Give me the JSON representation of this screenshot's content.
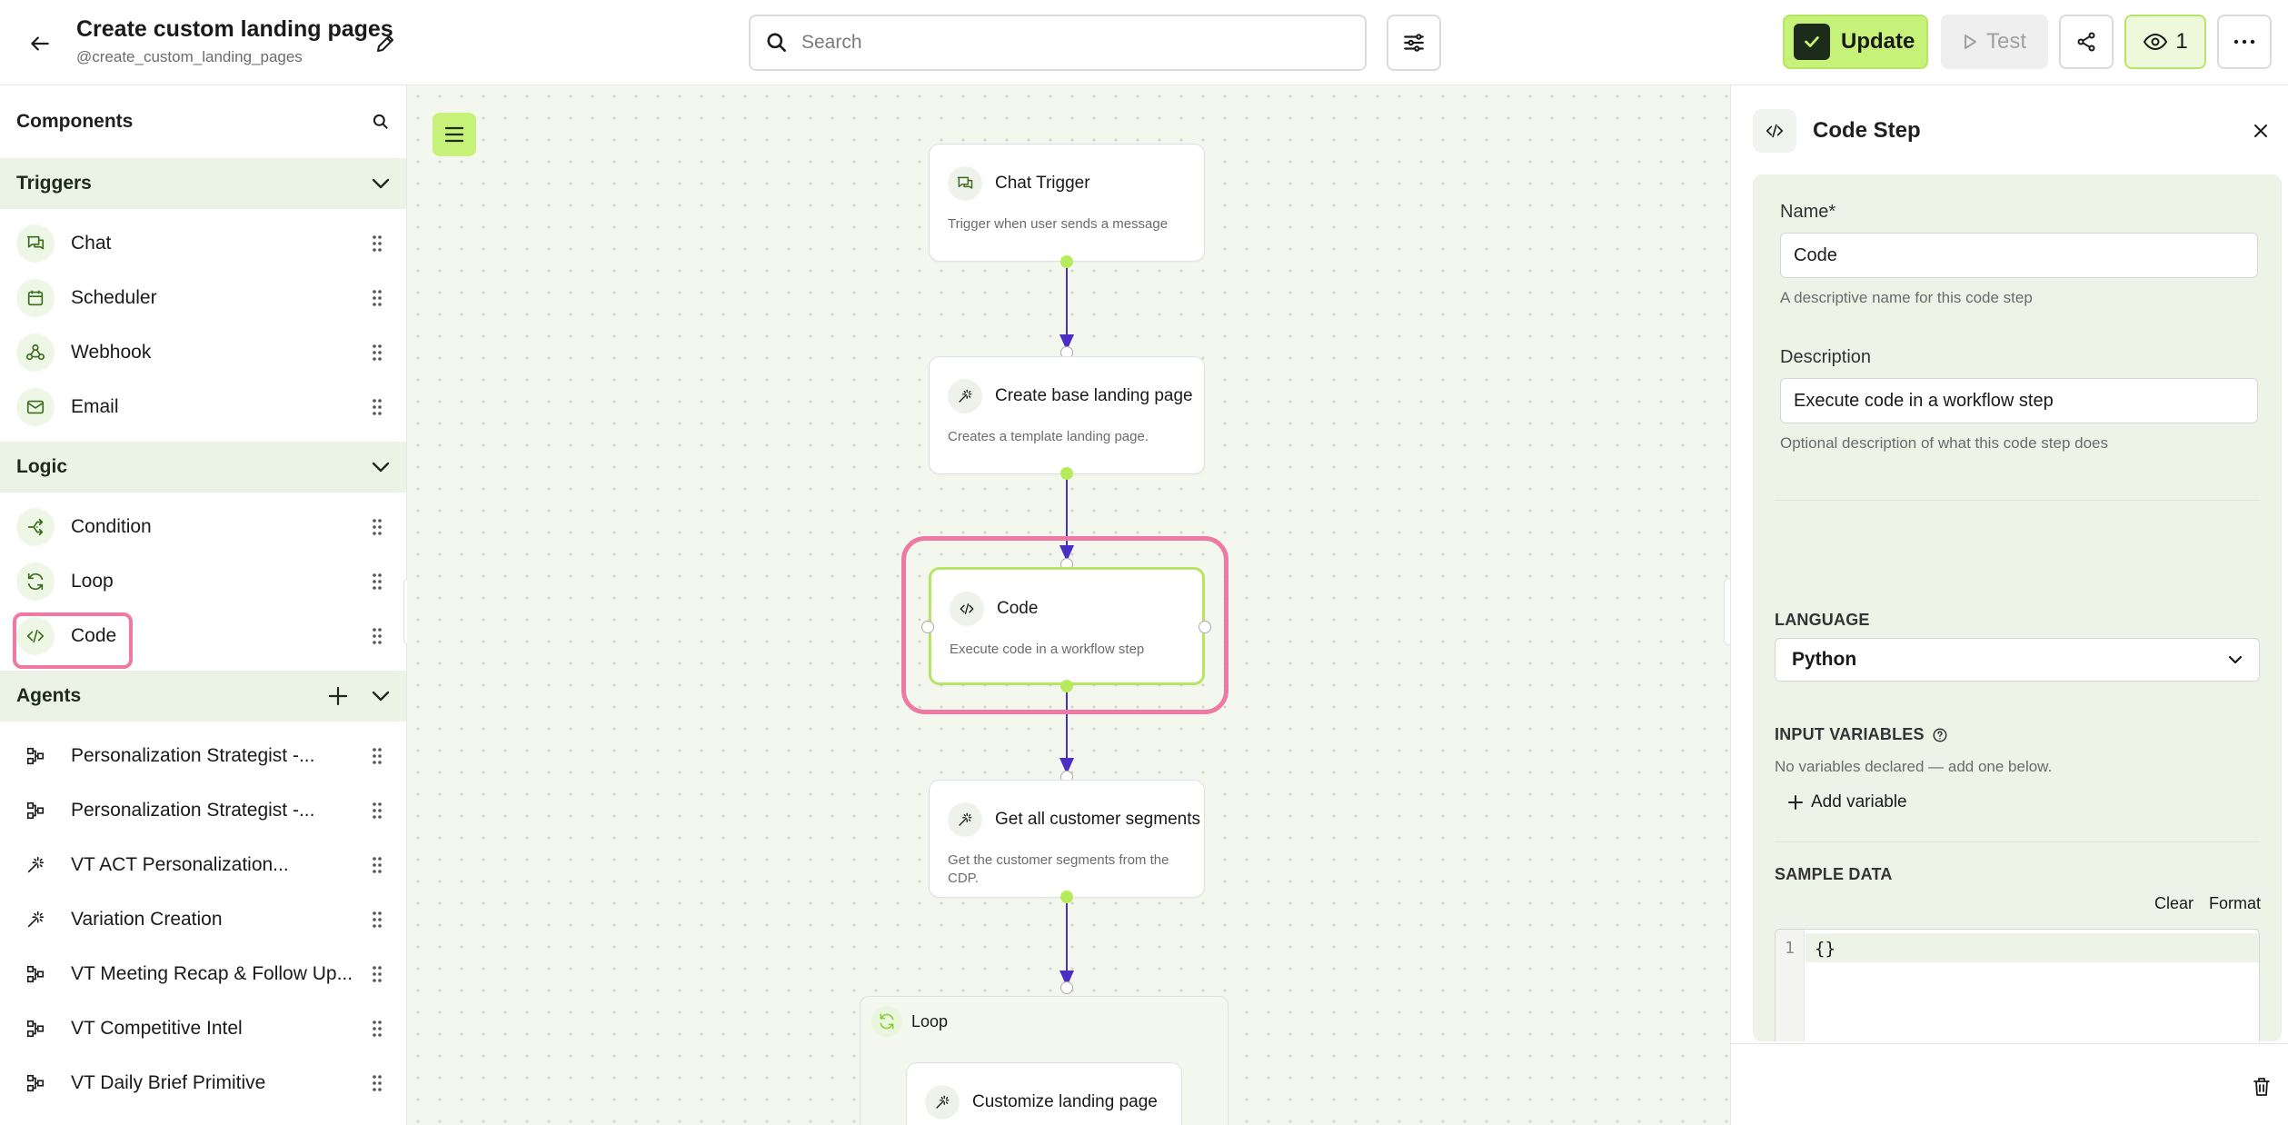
{
  "header": {
    "title": "Create custom landing pages",
    "subtitle": "@create_custom_landing_pages",
    "search_placeholder": "Search",
    "update_label": "Update",
    "test_label": "Test",
    "viewers_count": "1"
  },
  "sidebar": {
    "title": "Components",
    "sections": {
      "triggers": {
        "title": "Triggers",
        "items": [
          {
            "label": "Chat",
            "icon": "chat-icon"
          },
          {
            "label": "Scheduler",
            "icon": "calendar-icon"
          },
          {
            "label": "Webhook",
            "icon": "webhook-icon"
          },
          {
            "label": "Email",
            "icon": "mail-icon"
          }
        ]
      },
      "logic": {
        "title": "Logic",
        "items": [
          {
            "label": "Condition",
            "icon": "branch-icon"
          },
          {
            "label": "Loop",
            "icon": "loop-icon"
          },
          {
            "label": "Code",
            "icon": "code-icon"
          }
        ]
      },
      "agents": {
        "title": "Agents",
        "items": [
          {
            "label": "Personalization Strategist -...",
            "icon": "workflow-icon"
          },
          {
            "label": "Personalization Strategist -...",
            "icon": "workflow-icon"
          },
          {
            "label": "VT ACT Personalization...",
            "icon": "sparkle-icon"
          },
          {
            "label": "Variation Creation",
            "icon": "sparkle-icon"
          },
          {
            "label": "VT Meeting Recap & Follow Up...",
            "icon": "workflow-icon"
          },
          {
            "label": "VT Competitive Intel",
            "icon": "workflow-icon"
          },
          {
            "label": "VT Daily Brief Primitive",
            "icon": "workflow-icon"
          }
        ]
      }
    }
  },
  "canvas": {
    "nodes": {
      "chat_trigger": {
        "title": "Chat Trigger",
        "desc": "Trigger when user sends a message"
      },
      "base_page": {
        "title": "Create base landing page",
        "desc": "Creates a template landing page."
      },
      "code": {
        "title": "Code",
        "desc": "Execute code in a workflow step"
      },
      "segments": {
        "title": "Get all customer segments",
        "desc": "Get the customer segments from the CDP."
      },
      "loop": {
        "title": "Loop"
      },
      "customize": {
        "title": "Customize landing page"
      }
    }
  },
  "panel": {
    "title": "Code Step",
    "name_label": "Name",
    "name_required": "*",
    "name_value": "Code",
    "name_hint": "A descriptive name for this code step",
    "desc_label": "Description",
    "desc_value": "Execute code in a workflow step",
    "desc_hint": "Optional description of what this code step does",
    "language_label": "LANGUAGE",
    "language_value": "Python",
    "input_vars_label": "INPUT VARIABLES",
    "input_vars_empty": "No variables declared — add one below.",
    "add_variable_label": "Add variable",
    "sample_data_label": "SAMPLE DATA",
    "clear_label": "Clear",
    "format_label": "Format",
    "editor_line_number": "1",
    "editor_code": "{}"
  },
  "colors": {
    "accent_green": "#c7f27a",
    "highlight_pink": "#ee7aa3",
    "edge_purple": "#4b2fc4"
  }
}
